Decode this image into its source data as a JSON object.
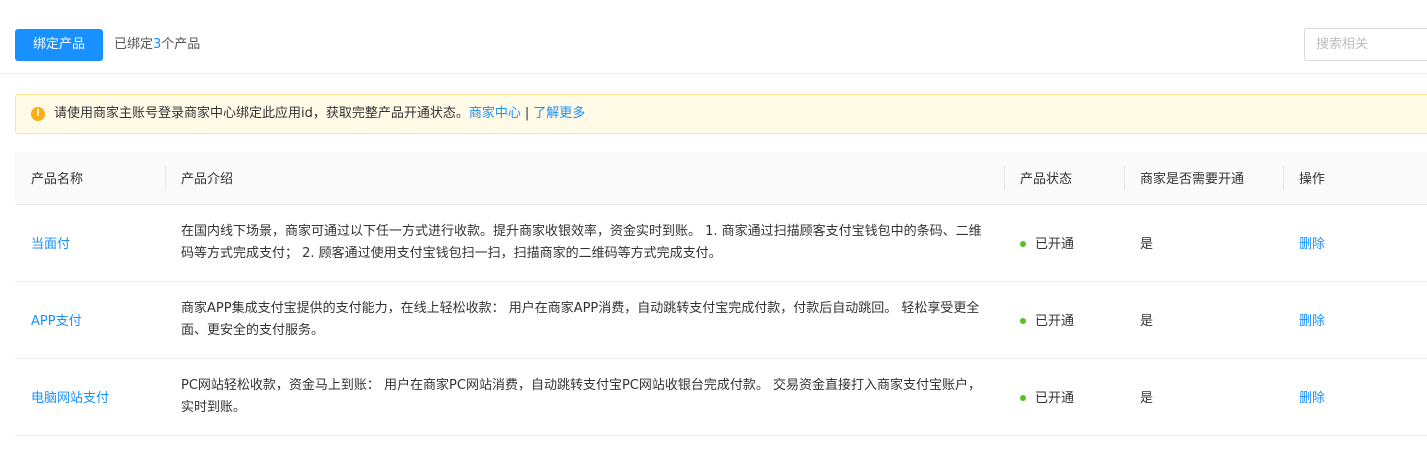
{
  "toolbar": {
    "bind_button_label": "绑定产品",
    "bound_prefix": "已绑定",
    "bound_count": "3",
    "bound_suffix": "个产品",
    "search_placeholder": "搜索相关"
  },
  "alert": {
    "icon": "warning-icon",
    "message": "请使用商家主账号登录商家中心绑定此应用id，获取完整产品开通状态。",
    "link_merchant_center": "商家中心",
    "separator": "|",
    "link_learn_more": "了解更多"
  },
  "table": {
    "columns": [
      "产品名称",
      "产品介绍",
      "产品状态",
      "商家是否需要开通",
      "操作"
    ],
    "rows": [
      {
        "name": "当面付",
        "description": "在国内线下场景，商家可通过以下任一方式进行收款。提升商家收银效率，资金实时到账。 1. 商家通过扫描顾客支付宝钱包中的条码、二维码等方式完成支付； 2. 顾客通过使用支付宝钱包扫一扫，扫描商家的二维码等方式完成支付。",
        "status": "已开通",
        "needs_activation": "是",
        "action": "删除"
      },
      {
        "name": "APP支付",
        "description": "商家APP集成支付宝提供的支付能力，在线上轻松收款： 用户在商家APP消费，自动跳转支付宝完成付款，付款后自动跳回。 轻松享受更全面、更安全的支付服务。",
        "status": "已开通",
        "needs_activation": "是",
        "action": "删除"
      },
      {
        "name": "电脑网站支付",
        "description": "PC网站轻松收款，资金马上到账： 用户在商家PC网站消费，自动跳转支付宝PC网站收银台完成付款。 交易资金直接打入商家支付宝账户，实时到账。",
        "status": "已开通",
        "needs_activation": "是",
        "action": "删除"
      }
    ]
  },
  "colors": {
    "primary": "#1890ff",
    "status_active": "#52c41a",
    "alert_bg": "#fffbe6",
    "alert_border": "#ffe58f",
    "warning": "#faad14"
  }
}
